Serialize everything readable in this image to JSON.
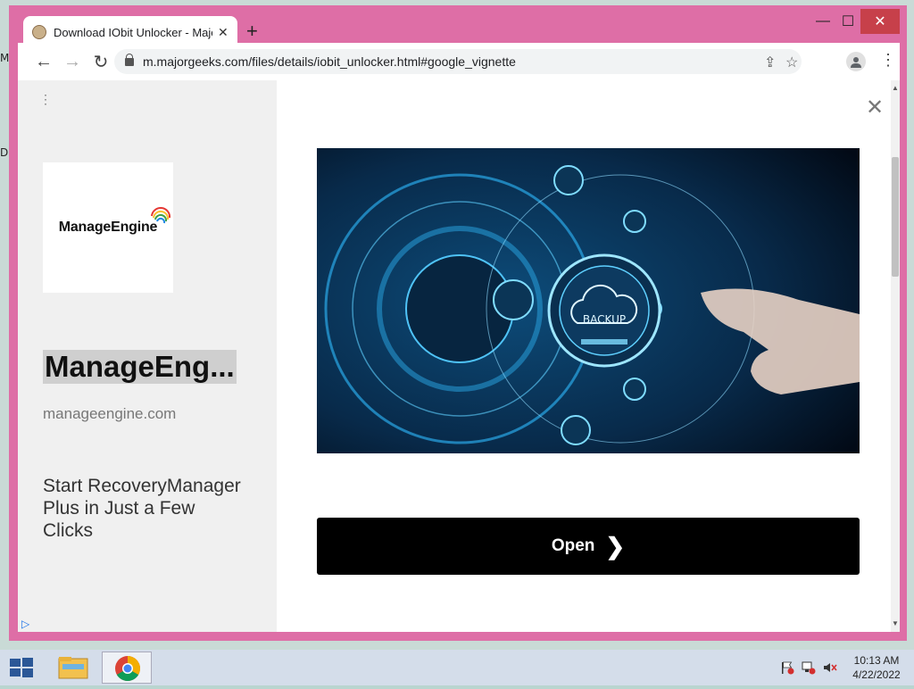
{
  "desktop": {
    "edge_letters": [
      "M",
      "D"
    ]
  },
  "window": {
    "minimize_glyph": "—",
    "maximize_glyph": "☐",
    "close_glyph": "✕",
    "frame_color": "#de6ea6"
  },
  "tab": {
    "title": "Download IObit Unlocker - Major",
    "close_glyph": "✕"
  },
  "new_tab_glyph": "+",
  "toolbar": {
    "back_glyph": "←",
    "forward_glyph": "→",
    "reload_glyph": "↻",
    "url": "m.majorgeeks.com/files/details/iobit_unlocker.html#google_vignette",
    "share_glyph": "⇪",
    "star_glyph": "☆",
    "menu_glyph": "⋮"
  },
  "ad": {
    "menu_glyph": "⋮",
    "logo_text": "ManageEngine",
    "title": "ManageEng...",
    "domain": "manageengine.com",
    "description": "Start RecoveryManager Plus in Just a Few Clicks",
    "adchoices_glyph": "▷",
    "close_glyph": "✕",
    "hero_label": "BACKUP",
    "cta_label": "Open",
    "cta_glyph": "❯"
  },
  "taskbar": {
    "icons": [
      "windows-start-icon",
      "file-explorer-icon",
      "chrome-icon"
    ],
    "tray": [
      "action-center-flag-icon",
      "network-icon",
      "volume-muted-icon"
    ],
    "time": "10:13 AM",
    "date": "4/22/2022"
  }
}
